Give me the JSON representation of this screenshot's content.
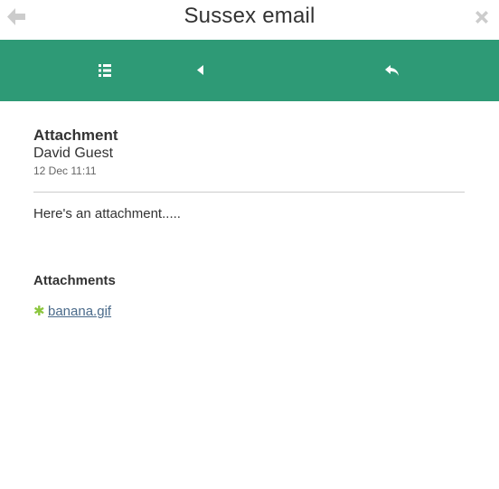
{
  "app": {
    "title": "Sussex email"
  },
  "colors": {
    "toolbar_bg": "#2e9a76",
    "attachment_bullet": "#8cc63f",
    "link": "#4a6a8a"
  },
  "icons": {
    "back": "arrow-left-icon",
    "close": "close-icon",
    "list": "list-icon",
    "previous": "triangle-left-icon",
    "reply": "reply-icon"
  },
  "message": {
    "subject": "Attachment",
    "from": "David Guest",
    "date": "12 Dec 11:11",
    "body": "Here's an attachment....."
  },
  "attachments": {
    "heading": "Attachments",
    "items": [
      {
        "bullet": "✱",
        "name": "banana.gif"
      }
    ]
  }
}
